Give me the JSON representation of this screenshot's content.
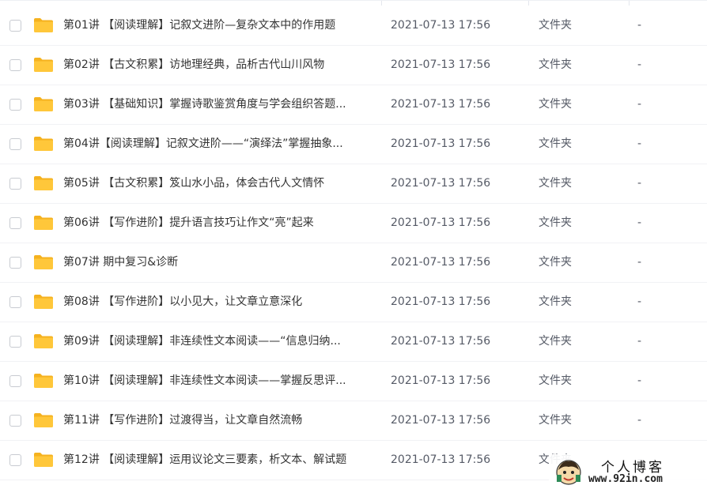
{
  "rows": [
    {
      "name": "第01讲 【阅读理解】记叙文进阶—复杂文本中的作用题",
      "date": "2021-07-13 17:56",
      "type": "文件夹",
      "size": "-"
    },
    {
      "name": "第02讲 【古文积累】访地理经典，品析古代山川风物",
      "date": "2021-07-13 17:56",
      "type": "文件夹",
      "size": "-"
    },
    {
      "name": "第03讲 【基础知识】掌握诗歌鉴赏角度与学会组织答题...",
      "date": "2021-07-13 17:56",
      "type": "文件夹",
      "size": "-"
    },
    {
      "name": "第04讲【阅读理解】记叙文进阶——“演绎法”掌握抽象...",
      "date": "2021-07-13 17:56",
      "type": "文件夹",
      "size": "-"
    },
    {
      "name": "第05讲 【古文积累】笈山水小品，体会古代人文情怀",
      "date": "2021-07-13 17:56",
      "type": "文件夹",
      "size": "-"
    },
    {
      "name": "第06讲 【写作进阶】提升语言技巧让作文“亮”起来",
      "date": "2021-07-13 17:56",
      "type": "文件夹",
      "size": "-"
    },
    {
      "name": "第07讲 期中复习&诊断",
      "date": "2021-07-13 17:56",
      "type": "文件夹",
      "size": "-"
    },
    {
      "name": "第08讲 【写作进阶】以小见大，让文章立意深化",
      "date": "2021-07-13 17:56",
      "type": "文件夹",
      "size": "-"
    },
    {
      "name": "第09讲 【阅读理解】非连续性文本阅读——“信息归纳...",
      "date": "2021-07-13 17:56",
      "type": "文件夹",
      "size": "-"
    },
    {
      "name": "第10讲 【阅读理解】非连续性文本阅读——掌握反思评...",
      "date": "2021-07-13 17:56",
      "type": "文件夹",
      "size": "-"
    },
    {
      "name": "第11讲 【写作进阶】过渡得当，让文章自然流畅",
      "date": "2021-07-13 17:56",
      "type": "文件夹",
      "size": "-"
    },
    {
      "name": "第12讲 【阅读理解】运用议论文三要素，析文本、解试题",
      "date": "2021-07-13 17:56",
      "type": "文件夹",
      "size": "-"
    }
  ],
  "watermark": {
    "title": "个人博客",
    "url": "www.92in.com"
  },
  "colors": {
    "folder": "#FFC73A",
    "folder_tab": "#F5B21F",
    "text": "#333333",
    "meta_text": "#555A66"
  },
  "icons": {
    "row_icon": "folder-icon",
    "watermark_icon": "avatar-icon"
  }
}
